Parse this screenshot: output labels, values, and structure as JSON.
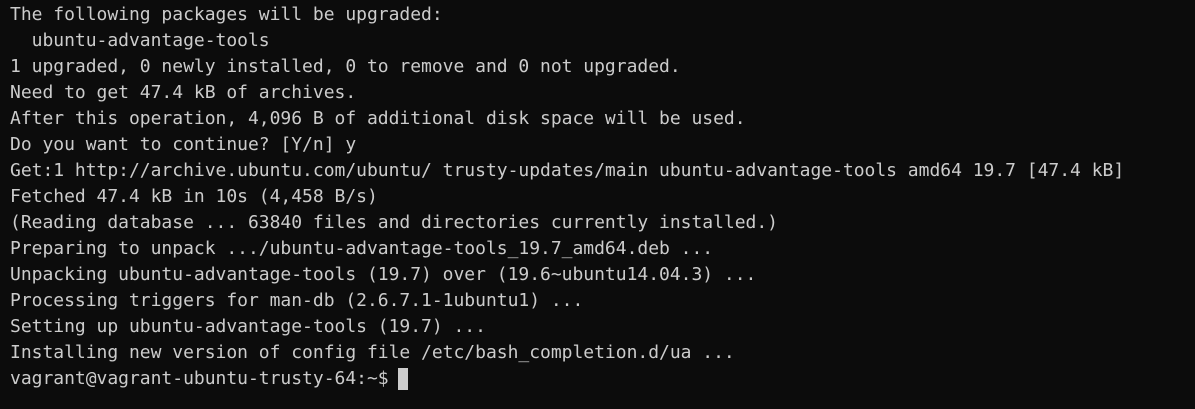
{
  "terminal": {
    "lines": [
      "The following packages will be upgraded:",
      "  ubuntu-advantage-tools",
      "1 upgraded, 0 newly installed, 0 to remove and 0 not upgraded.",
      "Need to get 47.4 kB of archives.",
      "After this operation, 4,096 B of additional disk space will be used.",
      "Do you want to continue? [Y/n] y",
      "Get:1 http://archive.ubuntu.com/ubuntu/ trusty-updates/main ubuntu-advantage-tools amd64 19.7 [47.4 kB]",
      "Fetched 47.4 kB in 10s (4,458 B/s)",
      "(Reading database ... 63840 files and directories currently installed.)",
      "Preparing to unpack .../ubuntu-advantage-tools_19.7_amd64.deb ...",
      "Unpacking ubuntu-advantage-tools (19.7) over (19.6~ubuntu14.04.3) ...",
      "Processing triggers for man-db (2.6.7.1-1ubuntu1) ...",
      "Setting up ubuntu-advantage-tools (19.7) ...",
      "Installing new version of config file /etc/bash_completion.d/ua ..."
    ],
    "prompt": "vagrant@vagrant-ubuntu-trusty-64:~$",
    "colors": {
      "background": "#0c0c0c",
      "foreground": "#cccccc",
      "cursor": "#cccccc"
    }
  }
}
